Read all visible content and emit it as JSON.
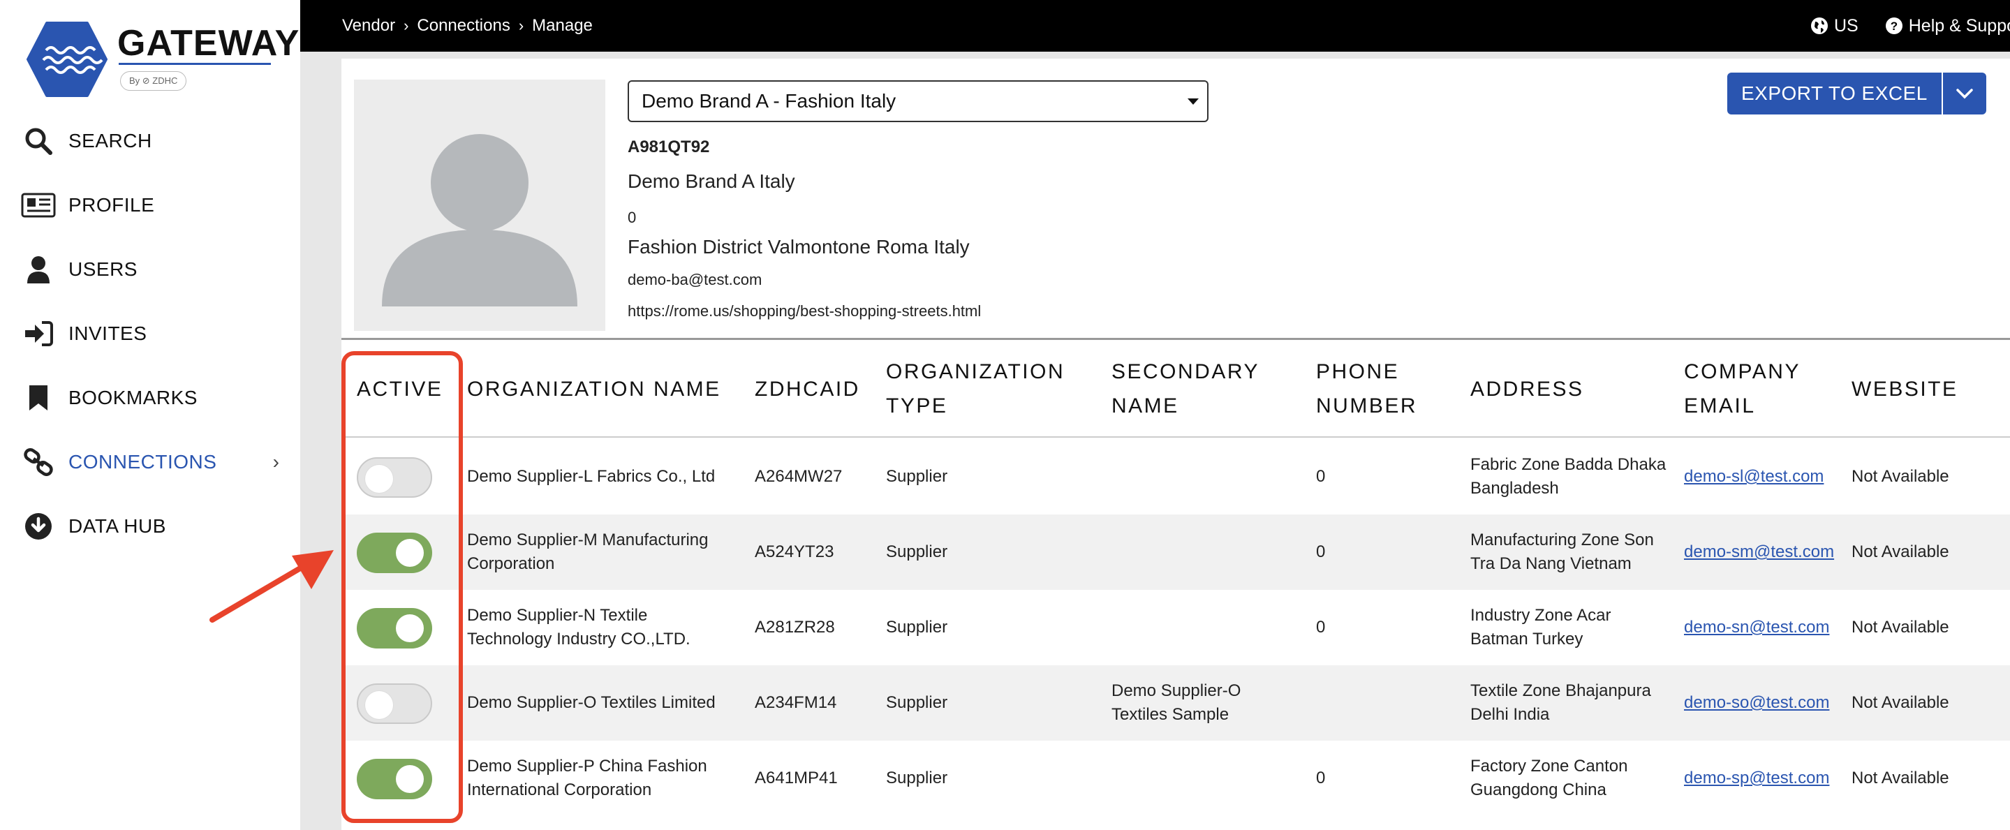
{
  "app": {
    "logo_text": "GATEWAY",
    "logo_sub": "By ⊘ ZDHC"
  },
  "sidebar": {
    "items": [
      {
        "label": "SEARCH",
        "icon": "search-icon"
      },
      {
        "label": "PROFILE",
        "icon": "profile-card-icon"
      },
      {
        "label": "USERS",
        "icon": "user-icon"
      },
      {
        "label": "INVITES",
        "icon": "sign-in-icon"
      },
      {
        "label": "BOOKMARKS",
        "icon": "bookmark-icon"
      },
      {
        "label": "CONNECTIONS",
        "icon": "link-icon",
        "active": true
      },
      {
        "label": "DATA HUB",
        "icon": "download-circle-icon"
      }
    ],
    "accent": "#2a55b0"
  },
  "topbar": {
    "breadcrumb": [
      "Vendor",
      "Connections",
      "Manage"
    ],
    "region": "US",
    "help": "Help & Support"
  },
  "profile": {
    "brand_select": "Demo Brand A - Fashion Italy",
    "id": "A981QT92",
    "name": "Demo Brand A Italy",
    "phone": "0",
    "address": "Fashion District Valmontone Roma Italy",
    "email": "demo-ba@test.com",
    "website": "https://rome.us/shopping/best-shopping-streets.html",
    "export_label": "EXPORT TO EXCEL"
  },
  "table": {
    "headers": {
      "active": "ACTIVE",
      "org_name": "ORGANIZATION NAME",
      "zdhcaid": "ZDHCAID",
      "org_type_1": "ORGANIZATION",
      "org_type_2": "TYPE",
      "secondary_1": "SECONDARY",
      "secondary_2": "NAME",
      "phone_1": "PHONE",
      "phone_2": "NUMBER",
      "address": "ADDRESS",
      "email_1": "COMPANY",
      "email_2": "EMAIL",
      "website": "WEBSITE"
    },
    "rows": [
      {
        "active": false,
        "name": "Demo Supplier-L Fabrics Co., Ltd",
        "zdhcaid": "A264MW27",
        "type": "Supplier",
        "secondary": "",
        "phone": "0",
        "address": "Fabric Zone Badda Dhaka Bangladesh",
        "email": "demo-sl@test.com",
        "website": "Not Available"
      },
      {
        "active": true,
        "name": "Demo Supplier-M Manufacturing Corporation",
        "zdhcaid": "A524YT23",
        "type": "Supplier",
        "secondary": "",
        "phone": "0",
        "address": "Manufacturing Zone Son Tra Da Nang Vietnam",
        "email": "demo-sm@test.com",
        "website": "Not Available"
      },
      {
        "active": true,
        "name": "Demo Supplier-N Textile Technology Industry CO.,LTD.",
        "zdhcaid": "A281ZR28",
        "type": "Supplier",
        "secondary": "",
        "phone": "0",
        "address": "Industry Zone Acar Batman Turkey",
        "email": "demo-sn@test.com",
        "website": "Not Available"
      },
      {
        "active": false,
        "name": "Demo Supplier-O Textiles Limited",
        "zdhcaid": "A234FM14",
        "type": "Supplier",
        "secondary": "Demo Supplier-O Textiles Sample",
        "phone": "",
        "address": "Textile Zone Bhajanpura Delhi India",
        "email": "demo-so@test.com",
        "website": "Not Available"
      },
      {
        "active": true,
        "name": "Demo Supplier-P China Fashion International Corporation",
        "zdhcaid": "A641MP41",
        "type": "Supplier",
        "secondary": "",
        "phone": "0",
        "address": "Factory Zone Canton Guangdong China",
        "email": "demo-sp@test.com",
        "website": "Not Available"
      }
    ]
  },
  "colors": {
    "toggle_on": "#7ea95c",
    "toggle_off": "#e4e4e4",
    "annotation": "#e8432b",
    "button": "#2a55b0"
  }
}
